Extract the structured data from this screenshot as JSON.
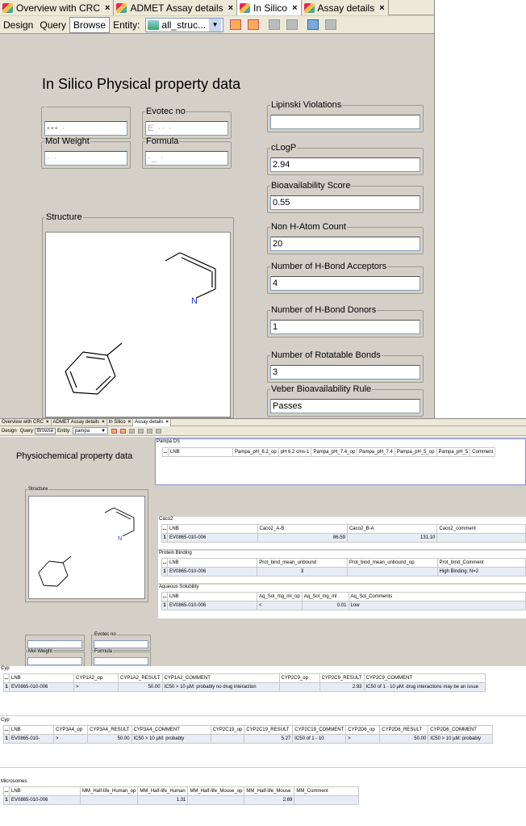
{
  "top": {
    "tabs": [
      {
        "label": "Overview with CRC",
        "close": "×"
      },
      {
        "label": "ADMET Assay details",
        "close": "×"
      },
      {
        "label": "In Silico",
        "close": "×"
      },
      {
        "label": "Assay details",
        "close": "×"
      }
    ],
    "toolbar": {
      "design": "Design",
      "query": "Query",
      "browse": "Browse",
      "entity_label": "Entity:",
      "entity_value": "all_struc...",
      "dropdown_arrow": "▼"
    },
    "title": "In Silico Physical property data",
    "fields": {
      "lnb": {
        "label": "",
        "value": ""
      },
      "evotec": {
        "label": "Evotec no",
        "value": ""
      },
      "molweight": {
        "label": "Mol Weight",
        "value": ""
      },
      "formula": {
        "label": "Formula",
        "value": ""
      },
      "lipinski": {
        "label": "Lipinski Violations",
        "value": ""
      },
      "clogp": {
        "label": "cLogP",
        "value": "2.94"
      },
      "bioavail": {
        "label": "Bioavailability Score",
        "value": "0.55"
      },
      "nonh": {
        "label": "Non H-Atom Count",
        "value": "20"
      },
      "hba": {
        "label": "Number of H-Bond Acceptors",
        "value": "4"
      },
      "hbd": {
        "label": "Number of H-Bond Donors",
        "value": "1"
      },
      "rotb": {
        "label": "Number of Rotatable Bonds",
        "value": "3"
      },
      "veber": {
        "label": "Veber Bioavailability Rule",
        "value": "Passes"
      }
    },
    "structure_label": "Structure",
    "atom_n": "N"
  },
  "bottom": {
    "tabs": [
      {
        "label": "Overview with CRC",
        "close": "×"
      },
      {
        "label": "ADMET Assay details",
        "close": "×"
      },
      {
        "label": "In Silico",
        "close": "×"
      },
      {
        "label": "Assay details",
        "close": "×"
      }
    ],
    "toolbar": {
      "design": "Design",
      "query": "Query",
      "browse": "Browse",
      "entity_label": "Entity:",
      "entity_value": "pampa",
      "dropdown_arrow": "▼"
    },
    "title": "Physiochemical property data",
    "structure_label": "Structure",
    "atom_n": "N",
    "fields": {
      "evotec": "Evotec no",
      "molweight": "Mol Weight",
      "formula": "Formula"
    },
    "pampa": {
      "label": "Pampa DS",
      "headers": [
        "LNB",
        "Pampa_pH_6.2_op",
        "pH 6.2 cms-1",
        "Pampa_pH_7.4_op",
        "Pampa_pH_7.4",
        "Pampa_pH_5_op",
        "Pampa_pH_5",
        "Comment"
      ]
    },
    "caco2": {
      "label": "Caco2",
      "headers": [
        "LNB",
        "Caco2_A-B",
        "Caco2_B-A",
        "Caco2_comment"
      ],
      "row": [
        "1",
        "EV0865-010-006",
        "86.59",
        "131.10",
        ""
      ]
    },
    "protein": {
      "label": "Protein Binding",
      "headers": [
        "LNB",
        "Prot_bind_mean_unbound",
        "Prot_bind_mean_unbound_op",
        "Prot_bind_Comment"
      ],
      "row": [
        "1",
        "EV0865-010-006",
        "3",
        "",
        "High Binding; N=2"
      ]
    },
    "aqueous": {
      "label": "Aqueous Solubility",
      "headers": [
        "LNB",
        "Aq_Sol_mg_ml_op",
        "Aq_Sol_mg_ml",
        "Aq_Sol_Comments"
      ],
      "row": [
        "1",
        "EV0865-010-006",
        "<",
        "0.01",
        "Low"
      ]
    },
    "cyp1": {
      "label": "Cyp",
      "headers": [
        "LNB",
        "CYP1A2_op",
        "CYP1A2_RESULT",
        "CYP1A2_COMMENT",
        "CYP2C9_op",
        "CYP2C9_RESULT",
        "CYP2C9_COMMENT"
      ],
      "row": [
        "1",
        "EV0865-010-006",
        ">",
        "50.00",
        "IC50 > 10 µM: probably no drug interaction",
        "",
        "2.93",
        "IC50 of 1 - 10 µM: drug interactions may be an issue"
      ]
    },
    "cyp2": {
      "label": "Cyp",
      "headers": [
        "LNB",
        "CYP3A4_op",
        "CYP3A4_RESULT",
        "CYP3A4_COMMENT",
        "CYP2C19_op",
        "CYP2C19_RESULT",
        "CYP2C19_COMMENT",
        "CYP2D6_op",
        "CYP2D6_RESULT",
        "CYP2D6_COMMENT"
      ],
      "row": [
        "1",
        "EV0865-010-",
        ">",
        "50.00",
        "IC50 > 10 µM: probably",
        "",
        "5.27",
        "IC50 of 1 - 10",
        ">",
        "50.00",
        "IC50 > 10 µM: probably"
      ]
    },
    "micro": {
      "label": "Microsomes",
      "headers": [
        "LNB",
        "MM_Half-life_Human_op",
        "MM_Half-life_Human",
        "MM_Half-life_Mouse_op",
        "MM_Half-life_Mouse",
        "MM_Comment"
      ],
      "row": [
        "1",
        "EV0865-010-006",
        "",
        "1.31",
        "",
        "2.69",
        ""
      ]
    }
  }
}
